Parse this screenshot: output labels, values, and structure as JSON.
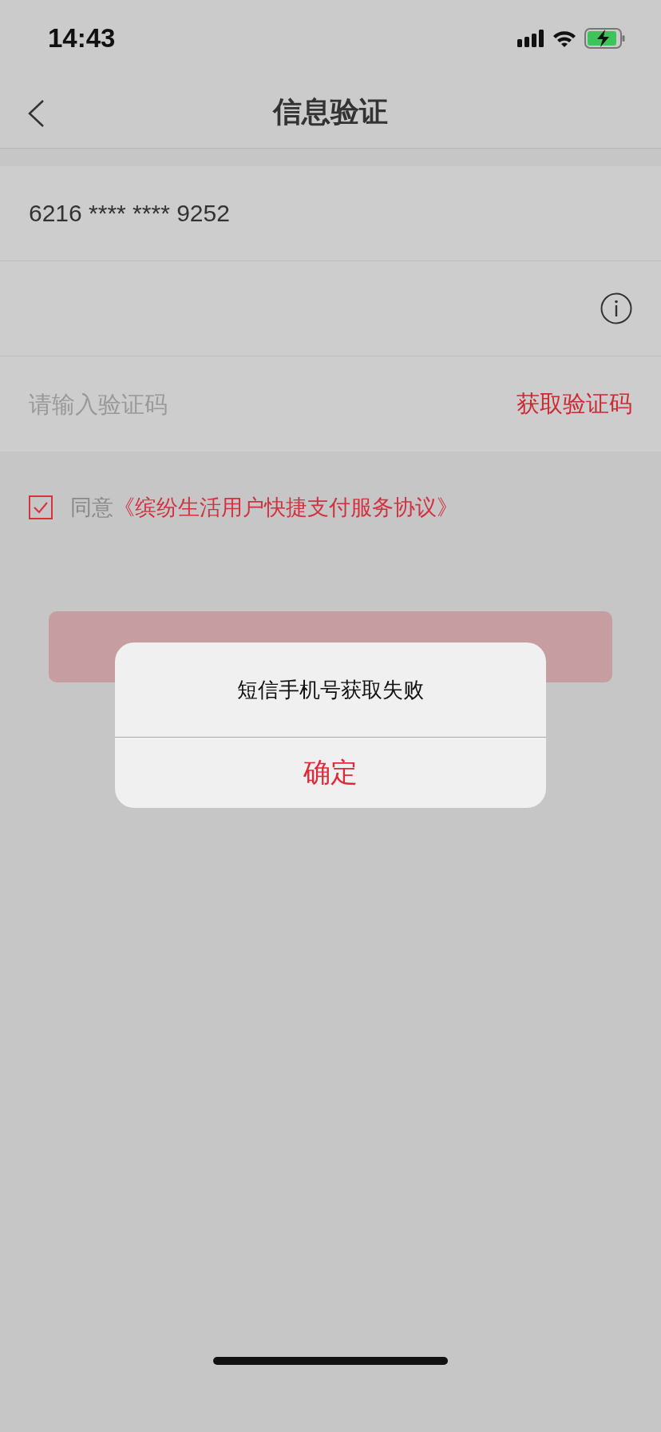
{
  "status_bar": {
    "time": "14:43"
  },
  "nav": {
    "title": "信息验证"
  },
  "card_number": "6216 **** **** 9252",
  "code_field": {
    "placeholder": "请输入验证码",
    "action": "获取验证码"
  },
  "agreement": {
    "checked": true,
    "label": "同意",
    "link": "《缤纷生活用户快捷支付服务协议》"
  },
  "submit_button": {
    "disabled": true
  },
  "alert": {
    "message": "短信手机号获取失败",
    "button": "确定"
  }
}
